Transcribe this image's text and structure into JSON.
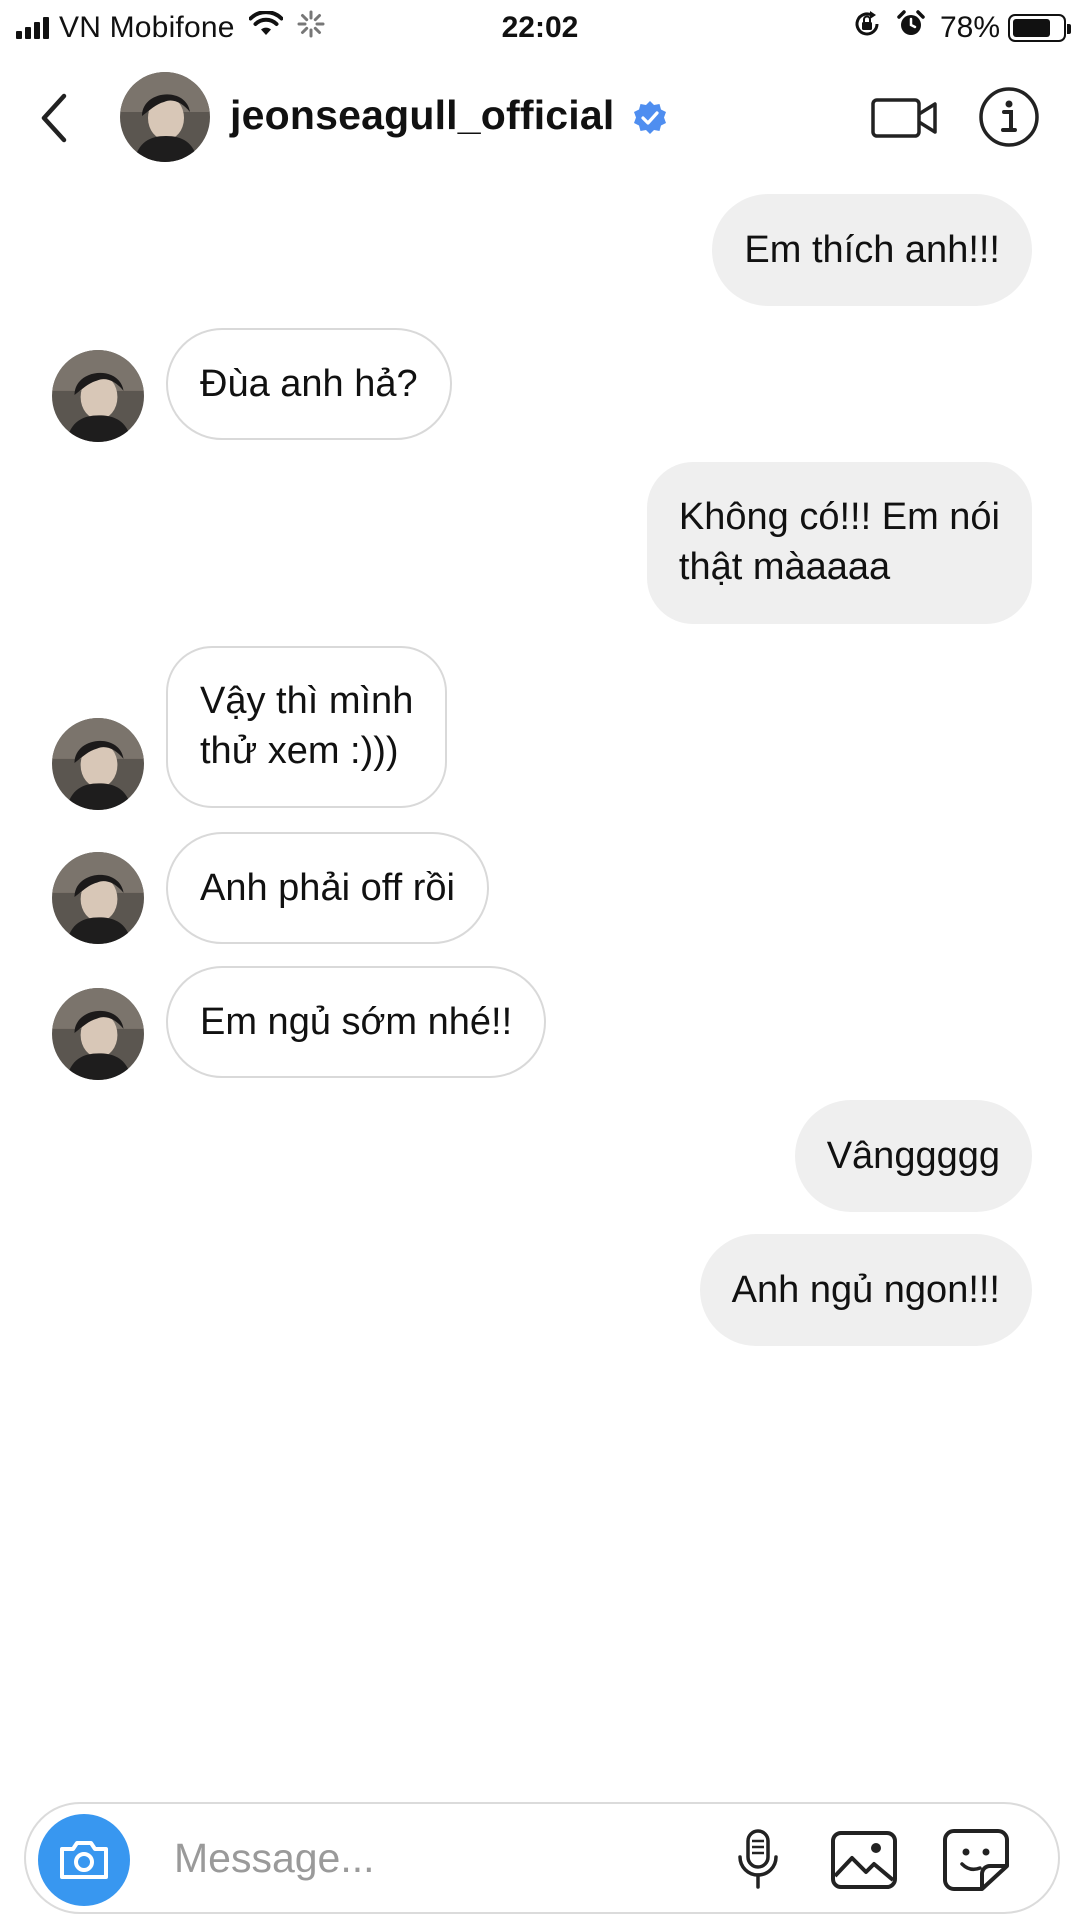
{
  "status_bar": {
    "carrier": "VN Mobifone",
    "time": "22:02",
    "battery_percent": "78%",
    "battery_level": 0.78,
    "icons": [
      "signal-icon",
      "wifi-icon",
      "activity-spinner-icon",
      "orientation-lock-icon",
      "alarm-icon",
      "battery-icon"
    ]
  },
  "header": {
    "username": "jeonseagull_official",
    "verified": true,
    "icons": [
      "back-chevron-icon",
      "avatar",
      "verified-badge-icon",
      "video-call-icon",
      "info-icon"
    ]
  },
  "messages": [
    {
      "direction": "sent",
      "text": "Em thích anh!!!"
    },
    {
      "direction": "received",
      "text": "Đùa anh hả?"
    },
    {
      "direction": "sent",
      "text": "Không có!!! Em nói thật màaaaa",
      "lines": [
        "Không có!!! Em nói",
        "thật màaaaa"
      ]
    },
    {
      "direction": "received",
      "text": "Vậy thì mình thử xem :)))",
      "lines": [
        "Vậy thì mình",
        "thử xem :)))"
      ]
    },
    {
      "direction": "received",
      "text": "Anh phải off rồi"
    },
    {
      "direction": "received",
      "text": "Em ngủ sớm nhé!!"
    },
    {
      "direction": "sent",
      "text": "Vânggggg"
    },
    {
      "direction": "sent",
      "text": "Anh ngủ ngon!!!"
    }
  ],
  "composer": {
    "placeholder": "Message...",
    "icons": [
      "camera-icon",
      "microphone-icon",
      "gallery-icon",
      "sticker-icon"
    ]
  },
  "colors": {
    "accent_blue": "#3897f0",
    "verified_blue": "#4f8ef0",
    "sent_bubble": "#efefef",
    "received_border": "#d9d9d9"
  }
}
